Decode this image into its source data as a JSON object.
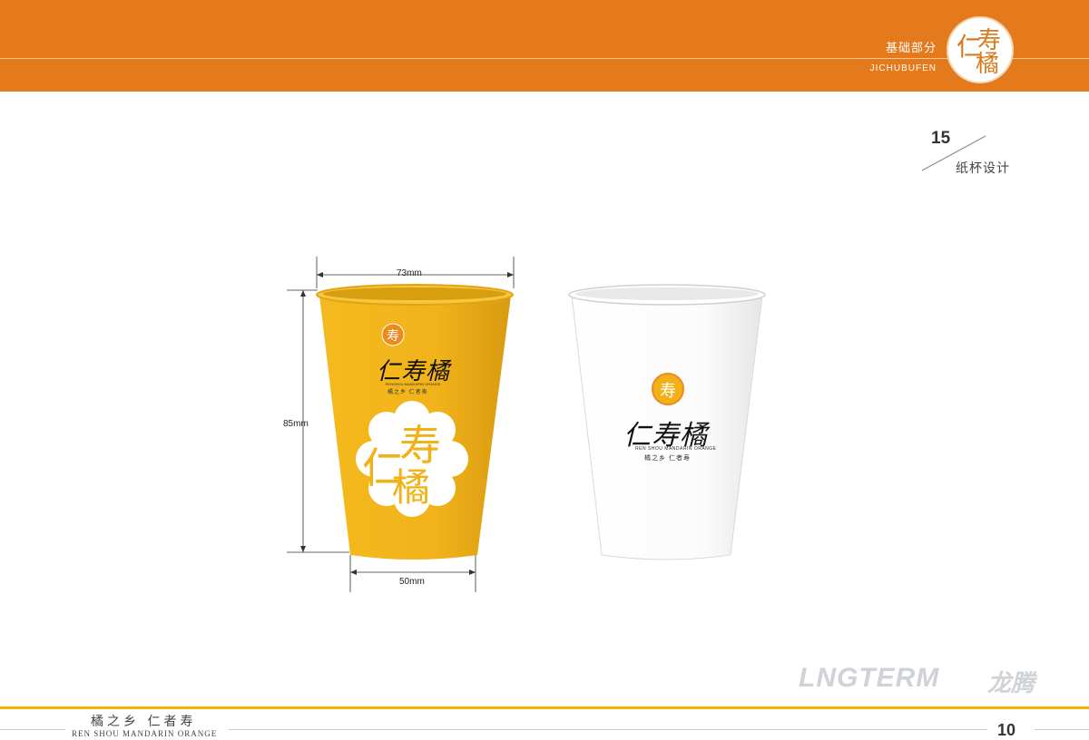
{
  "header": {
    "title": "基础部分",
    "subtitle": "JICHUBUFEN",
    "logo_glyphs": [
      "仁",
      "寿",
      "橘"
    ]
  },
  "section": {
    "number": "15",
    "label": "纸杯设计"
  },
  "cups": {
    "yellow": {
      "top_width": "73mm",
      "height": "85mm",
      "bottom_width": "50mm",
      "brand": "仁寿橘",
      "brand_en": "RENSHOU MANDARIN ORANGE",
      "slogan": "橘之乡  仁者寿",
      "big_glyphs": [
        "仁",
        "寿",
        "橘"
      ],
      "color": "#f2b217"
    },
    "white": {
      "brand": "仁寿橘",
      "brand_en": "REN SHOU MANDARIN ORANGE",
      "slogan": "橘之乡  仁者寿",
      "color": "#ffffff"
    }
  },
  "brand": {
    "name": "LNGTERM",
    "name_cn": "龙腾"
  },
  "footer": {
    "slogan": "橘之乡  仁者寿",
    "english": "REN SHOU MANDARIN ORANGE",
    "page": "10"
  }
}
